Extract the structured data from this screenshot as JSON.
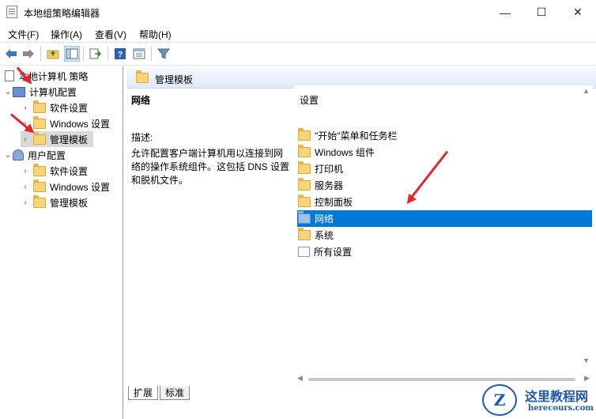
{
  "window": {
    "title": "本地组策略编辑器",
    "minimize_glyph": "—",
    "maximize_glyph": "☐",
    "close_glyph": "✕"
  },
  "menu": [
    "文件(F)",
    "操作(A)",
    "查看(V)",
    "帮助(H)"
  ],
  "toolbar_icons": [
    "back-arrow-icon",
    "forward-arrow-icon",
    "up-folder-icon",
    "show-hide-tree-icon",
    "export-list-icon",
    "help-icon",
    "properties-icon",
    "filter-icon"
  ],
  "tree": {
    "root": "本地计算机 策略",
    "computer_config": "计算机配置",
    "computer_children": [
      "软件设置",
      "Windows 设置",
      "管理模板"
    ],
    "user_config": "用户配置",
    "user_children": [
      "软件设置",
      "Windows 设置",
      "管理模板"
    ],
    "selected": "管理模板"
  },
  "detail": {
    "header_title": "管理模板",
    "ext_title": "网络",
    "ext_label": "描述:",
    "ext_description": "允许配置客户端计算机用以连接到网络的操作系统组件。这包括 DNS 设置和脱机文件。",
    "list_header": "设置",
    "items": [
      "\"开始\"菜单和任务栏",
      "Windows 组件",
      "打印机",
      "服务器",
      "控制面板",
      "网络",
      "系统",
      "所有设置"
    ],
    "selected_item": "网络"
  },
  "tabs": [
    "扩展",
    "标准"
  ],
  "active_tab": "扩展",
  "watermark": {
    "name": "这里教程网",
    "url": "herecours.com",
    "letter": "Z"
  },
  "colors": {
    "selection": "#0078d7",
    "arrow": "#e0252b",
    "header_band": "#dfe9f8"
  }
}
